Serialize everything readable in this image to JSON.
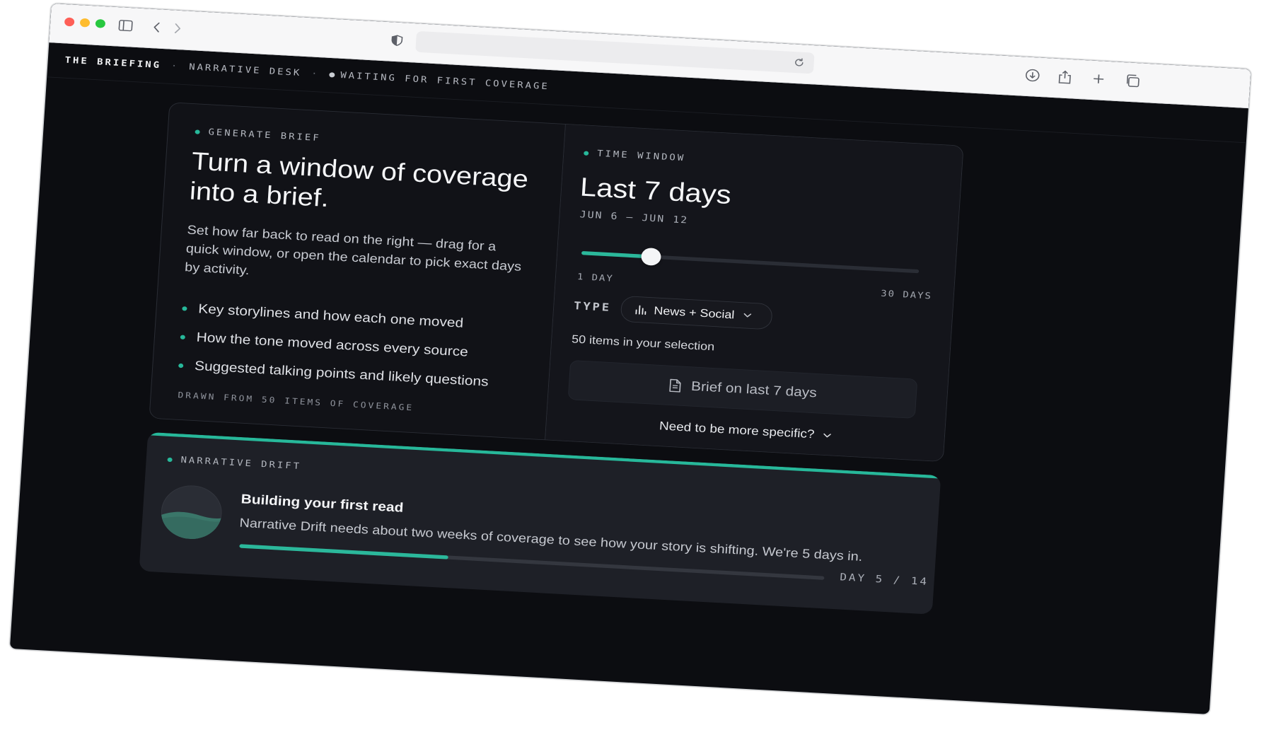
{
  "topbar": {
    "brand": "THE BRIEFING",
    "sep1": "·",
    "desk": "NARRATIVE DESK",
    "sep2": "·",
    "status": "WAITING FOR FIRST COVERAGE"
  },
  "generate": {
    "kicker": "GENERATE BRIEF",
    "headline_line1": "Turn a window of coverage",
    "headline_line2": "into a brief.",
    "description": "Set how far back to read on the right — drag for a quick window, or open the calendar to pick exact days by activity.",
    "bullets": [
      "Key storylines and how each one moved",
      "How the tone moved across every source",
      "Suggested talking points and likely questions"
    ],
    "footnote": "DRAWN FROM 50 ITEMS OF COVERAGE"
  },
  "time_window": {
    "kicker": "TIME WINDOW",
    "title": "Last 7 days",
    "dates": "JUN 6 — JUN 12",
    "slider": {
      "min": 1,
      "max": 30,
      "value": 7,
      "min_label": "1 DAY",
      "max_label": "30 DAYS"
    },
    "type_label": "TYPE",
    "type_value": "News + Social",
    "selection_count": "50 items in your selection",
    "brief_button": "Brief on last 7 days",
    "specific_toggle": "Need to be more specific?"
  },
  "drift": {
    "kicker": "NARRATIVE DRIFT",
    "title": "Building your first read",
    "subtitle": "Narrative Drift needs about two weeks of coverage to see how your story is shifting. We're 5 days in.",
    "progress": {
      "current": 5,
      "total": 14
    },
    "day_label": "DAY 5 / 14"
  },
  "colors": {
    "accent": "#27b89a",
    "background": "#0c0d11",
    "card": "#111217",
    "drift_card": "#1e2027"
  },
  "icons": {
    "sidebar": "sidebar-icon",
    "back": "chevron-left-icon",
    "forward": "chevron-right-icon",
    "shield": "shield-icon",
    "reload": "reload-icon",
    "download": "download-icon",
    "share": "share-icon",
    "new_tab": "plus-icon",
    "tabs": "tabs-icon",
    "type": "bar-chart-icon",
    "brief": "document-icon",
    "chevron": "chevron-down-icon"
  }
}
